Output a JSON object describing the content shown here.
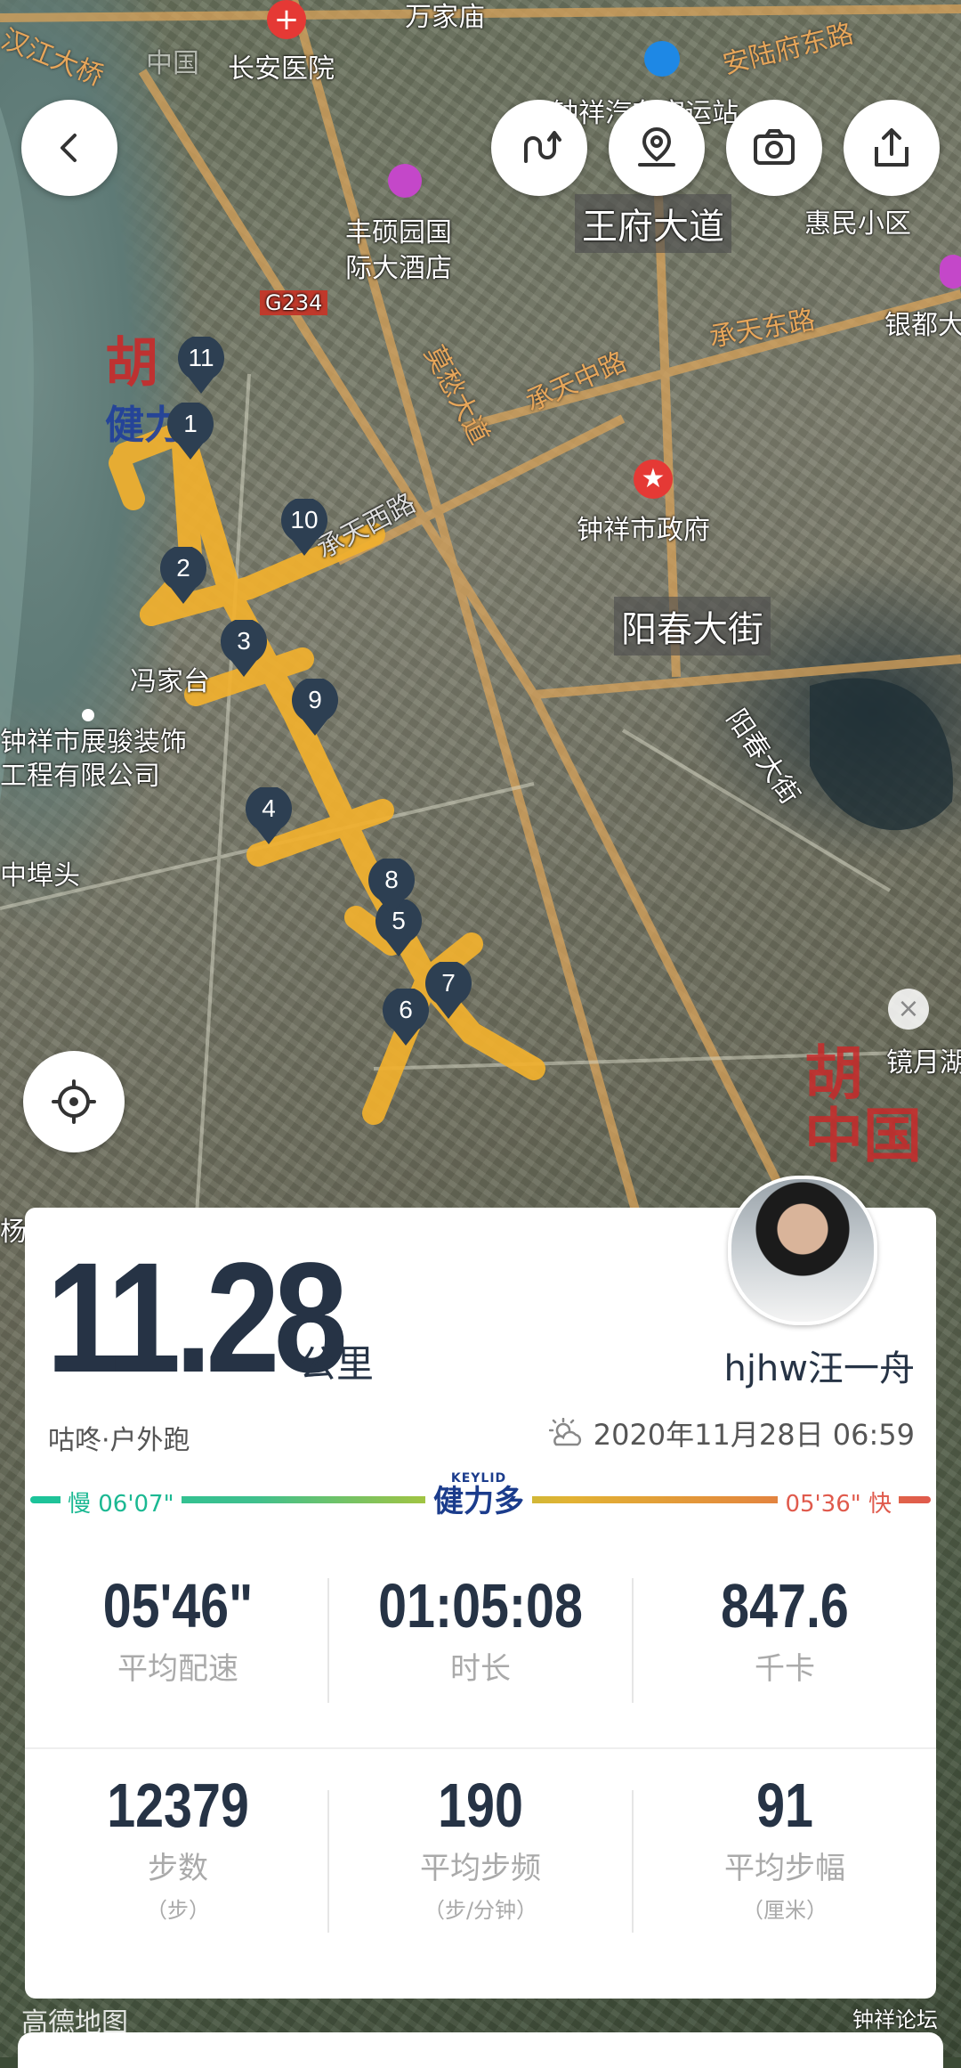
{
  "map": {
    "labels": {
      "l1": "长安医院",
      "l2": "万家庙",
      "l3": "汉江大桥",
      "l4": "安陆府东路",
      "l5": "钟祥汽车客运站",
      "l6": "丰硕园国",
      "l7": "际大酒店",
      "l8": "王府大道",
      "l9": "惠民小区",
      "l10": "G234",
      "l11": "承天东路",
      "l12": "承天中路",
      "l13": "莫愁大道",
      "l14": "银都大",
      "l15": "承天西路",
      "l16": "钟祥市政府",
      "l17": "阳春大街",
      "l18": "冯家台",
      "l19": "钟祥市展骏装饰",
      "l20": "工程有限公司",
      "l21": "阳春大街",
      "l22": "中埠头",
      "l23": "镜月湖",
      "l24": "杨",
      "l25": "中国"
    },
    "markers": [
      "1",
      "2",
      "3",
      "4",
      "5",
      "6",
      "7",
      "8",
      "9",
      "10",
      "11"
    ],
    "route_color": "#f2b12e",
    "watermark": "胡说中国"
  },
  "controls": {
    "back": "back",
    "route": "route-switch",
    "location": "map-pin",
    "camera": "camera",
    "share": "share",
    "locate": "locate"
  },
  "summary": {
    "distance": "11.28",
    "unit": "公里",
    "username": "hjhw汪一舟",
    "sport": "咕咚·户外跑",
    "datetime": "2020年11月28日 06:59",
    "pace_slow": "慢 06'07\"",
    "pace_fast": "05'36\" 快",
    "brand_en": "KEYLID",
    "brand_cn": "健力多"
  },
  "stats": {
    "avg_pace": {
      "value": "05'46\"",
      "label": "平均配速"
    },
    "duration": {
      "value": "01:05:08",
      "label": "时长"
    },
    "calories": {
      "value": "847.6",
      "label": "千卡"
    },
    "steps": {
      "value": "12379",
      "label": "步数",
      "sub": "（步）"
    },
    "cadence": {
      "value": "190",
      "label": "平均步频",
      "sub": "（步/分钟）"
    },
    "stride": {
      "value": "91",
      "label": "平均步幅",
      "sub": "（厘米）"
    }
  },
  "footer": {
    "map_provider": "高德地图",
    "forum": "钟祥论坛"
  }
}
